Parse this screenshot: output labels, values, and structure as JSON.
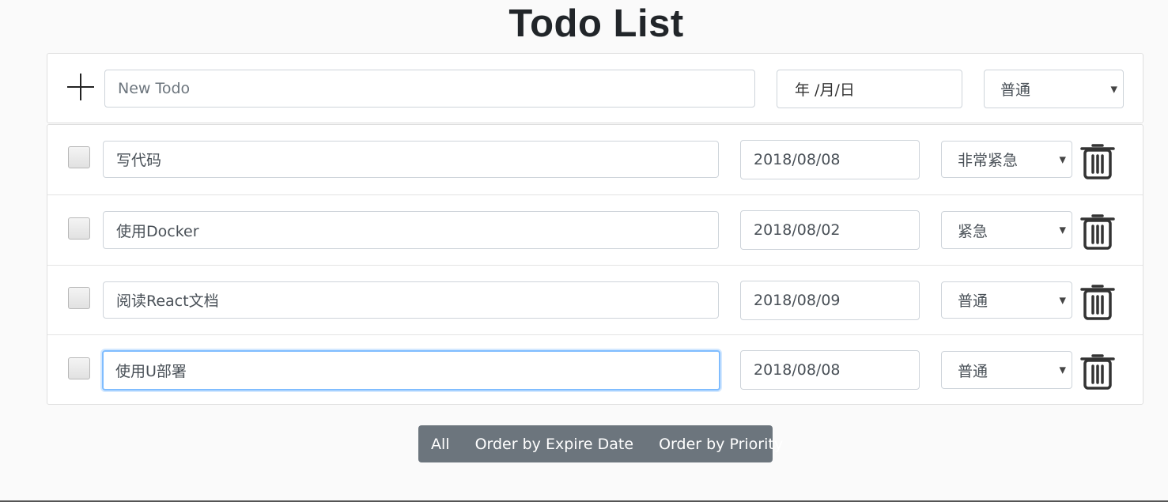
{
  "page": {
    "title": "Todo List"
  },
  "new_todo": {
    "placeholder": "New Todo",
    "date_placeholder": "年 /月/日",
    "priority": "普通"
  },
  "todos": [
    {
      "text": "写代码",
      "date": "2018/08/08",
      "priority": "非常紧急",
      "done": false
    },
    {
      "text": "使用Docker",
      "date": "2018/08/02",
      "priority": "紧急",
      "done": false
    },
    {
      "text": "阅读React文档",
      "date": "2018/08/09",
      "priority": "普通",
      "done": false
    },
    {
      "text": "使用U部署",
      "date": "2018/08/08",
      "priority": "普通",
      "done": false,
      "focused": true
    }
  ],
  "filters": {
    "all": "All",
    "by_expire": "Order by Expire Date",
    "by_priority": "Order by Priority"
  },
  "icons": {
    "add": "plus-icon",
    "delete": "trash-icon",
    "dropdown": "caret-down-icon"
  },
  "colors": {
    "filter_bar": "#6c757d",
    "focus_border": "#80bdff",
    "text": "#495057"
  }
}
